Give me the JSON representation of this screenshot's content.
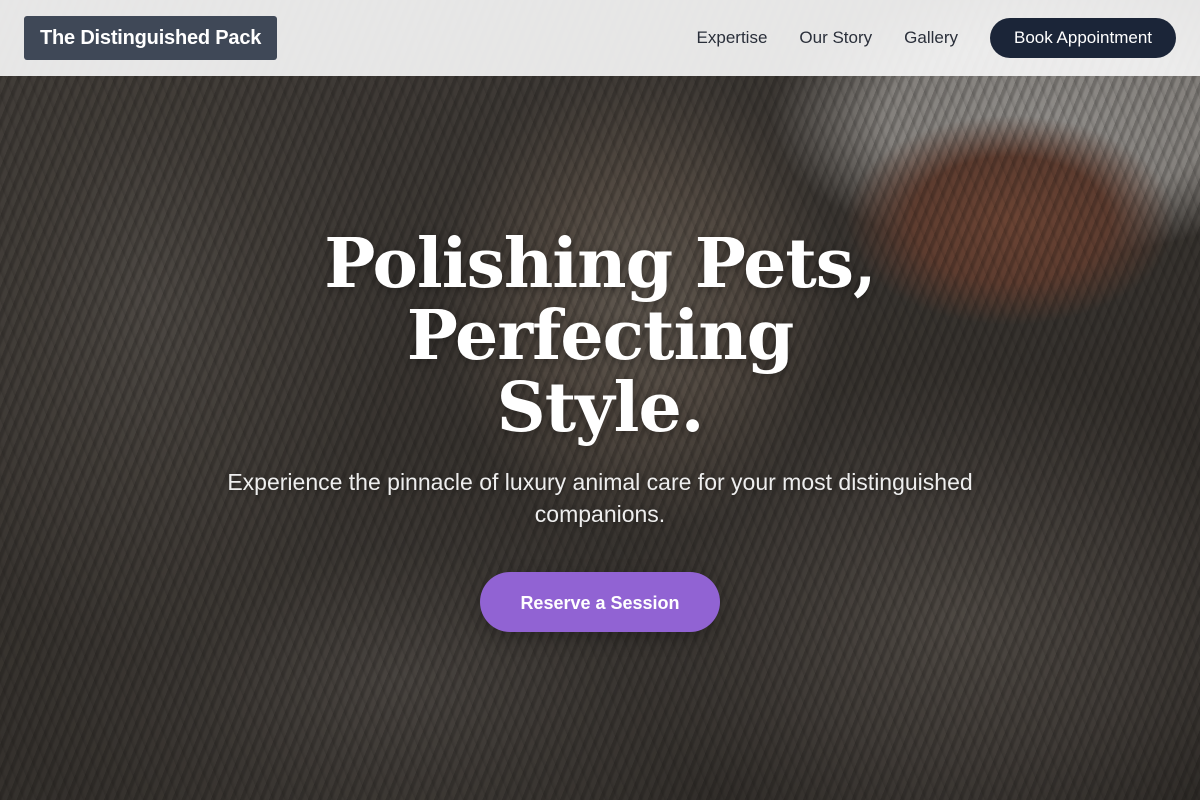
{
  "header": {
    "brand": "The Distinguished Pack",
    "nav": {
      "expertise": "Expertise",
      "our_story": "Our Story",
      "gallery": "Gallery"
    },
    "book_button": "Book Appointment"
  },
  "hero": {
    "title_line1": "Polishing Pets, Perfecting",
    "title_line2": "Style.",
    "subtitle": "Experience the pinnacle of luxury animal care for your most distinguished companions.",
    "cta": "Reserve a Session"
  },
  "colors": {
    "brand_bg": "#3f4857",
    "book_button_bg": "#1b2538",
    "cta_bg": "#9163d3",
    "header_bg": "#f4f4f4"
  }
}
